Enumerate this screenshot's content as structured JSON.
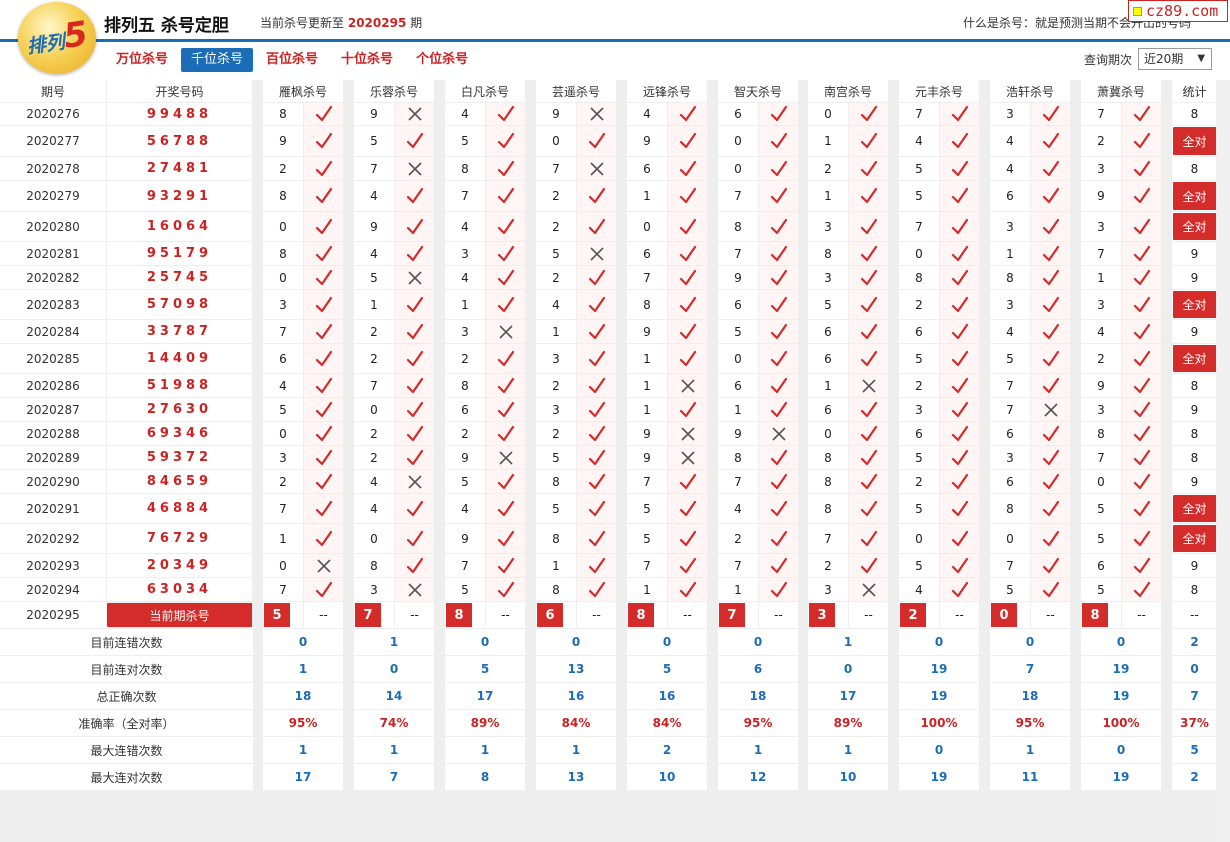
{
  "header": {
    "title": "排列五 杀号定胆",
    "logo_text": "排列",
    "logo_digit": "5",
    "update_prefix": "当前杀号更新至",
    "update_issue": "2020295",
    "update_suffix": "期",
    "what_is": "什么是杀号：就是预测当期不会开出的号码",
    "site_badge": "cz89.com"
  },
  "tabs": [
    {
      "label": "万位杀号"
    },
    {
      "label": "千位杀号"
    },
    {
      "label": "百位杀号"
    },
    {
      "label": "十位杀号"
    },
    {
      "label": "个位杀号"
    }
  ],
  "active_tab": 1,
  "query": {
    "label": "查询期次",
    "value": "近20期",
    "arrow": "▼"
  },
  "columns": {
    "issue": "期号",
    "draw": "开奖号码",
    "experts": [
      "雁枫杀号",
      "乐蓉杀号",
      "白凡杀号",
      "芸遥杀号",
      "远锋杀号",
      "智天杀号",
      "南宫杀号",
      "元丰杀号",
      "浩轩杀号",
      "萧冀杀号"
    ],
    "stat": "统计"
  },
  "rows": [
    {
      "issue": "2020276",
      "draw": "99488",
      "kills": [
        "8",
        "9",
        "4",
        "9",
        "4",
        "6",
        "0",
        "7",
        "3",
        "7"
      ],
      "ok": [
        1,
        0,
        1,
        0,
        1,
        1,
        1,
        1,
        1,
        1
      ],
      "stat": "8"
    },
    {
      "issue": "2020277",
      "draw": "56788",
      "kills": [
        "9",
        "5",
        "5",
        "0",
        "9",
        "0",
        "1",
        "4",
        "4",
        "2"
      ],
      "ok": [
        1,
        1,
        1,
        1,
        1,
        1,
        1,
        1,
        1,
        1
      ],
      "stat": "全对"
    },
    {
      "issue": "2020278",
      "draw": "27481",
      "kills": [
        "2",
        "7",
        "8",
        "7",
        "6",
        "0",
        "2",
        "5",
        "4",
        "3"
      ],
      "ok": [
        1,
        0,
        1,
        0,
        1,
        1,
        1,
        1,
        1,
        1
      ],
      "stat": "8"
    },
    {
      "issue": "2020279",
      "draw": "93291",
      "kills": [
        "8",
        "4",
        "7",
        "2",
        "1",
        "7",
        "1",
        "5",
        "6",
        "9"
      ],
      "ok": [
        1,
        1,
        1,
        1,
        1,
        1,
        1,
        1,
        1,
        1
      ],
      "stat": "全对"
    },
    {
      "issue": "2020280",
      "draw": "16064",
      "kills": [
        "0",
        "9",
        "4",
        "2",
        "0",
        "8",
        "3",
        "7",
        "3",
        "3"
      ],
      "ok": [
        1,
        1,
        1,
        1,
        1,
        1,
        1,
        1,
        1,
        1
      ],
      "stat": "全对"
    },
    {
      "issue": "2020281",
      "draw": "95179",
      "kills": [
        "8",
        "4",
        "3",
        "5",
        "6",
        "7",
        "8",
        "0",
        "1",
        "7"
      ],
      "ok": [
        1,
        1,
        1,
        0,
        1,
        1,
        1,
        1,
        1,
        1
      ],
      "stat": "9"
    },
    {
      "issue": "2020282",
      "draw": "25745",
      "kills": [
        "0",
        "5",
        "4",
        "2",
        "7",
        "9",
        "3",
        "8",
        "8",
        "1"
      ],
      "ok": [
        1,
        0,
        1,
        1,
        1,
        1,
        1,
        1,
        1,
        1
      ],
      "stat": "9"
    },
    {
      "issue": "2020283",
      "draw": "57098",
      "kills": [
        "3",
        "1",
        "1",
        "4",
        "8",
        "6",
        "5",
        "2",
        "3",
        "3"
      ],
      "ok": [
        1,
        1,
        1,
        1,
        1,
        1,
        1,
        1,
        1,
        1
      ],
      "stat": "全对"
    },
    {
      "issue": "2020284",
      "draw": "33787",
      "kills": [
        "7",
        "2",
        "3",
        "1",
        "9",
        "5",
        "6",
        "6",
        "4",
        "4"
      ],
      "ok": [
        1,
        1,
        0,
        1,
        1,
        1,
        1,
        1,
        1,
        1
      ],
      "stat": "9"
    },
    {
      "issue": "2020285",
      "draw": "14409",
      "kills": [
        "6",
        "2",
        "2",
        "3",
        "1",
        "0",
        "6",
        "5",
        "5",
        "2"
      ],
      "ok": [
        1,
        1,
        1,
        1,
        1,
        1,
        1,
        1,
        1,
        1
      ],
      "stat": "全对"
    },
    {
      "issue": "2020286",
      "draw": "51988",
      "kills": [
        "4",
        "7",
        "8",
        "2",
        "1",
        "6",
        "1",
        "2",
        "7",
        "9"
      ],
      "ok": [
        1,
        1,
        1,
        1,
        0,
        1,
        0,
        1,
        1,
        1
      ],
      "stat": "8"
    },
    {
      "issue": "2020287",
      "draw": "27630",
      "kills": [
        "5",
        "0",
        "6",
        "3",
        "1",
        "1",
        "6",
        "3",
        "7",
        "3"
      ],
      "ok": [
        1,
        1,
        1,
        1,
        1,
        1,
        1,
        1,
        0,
        1
      ],
      "stat": "9"
    },
    {
      "issue": "2020288",
      "draw": "69346",
      "kills": [
        "0",
        "2",
        "2",
        "2",
        "9",
        "9",
        "0",
        "6",
        "6",
        "8"
      ],
      "ok": [
        1,
        1,
        1,
        1,
        0,
        0,
        1,
        1,
        1,
        1
      ],
      "stat": "8"
    },
    {
      "issue": "2020289",
      "draw": "59372",
      "kills": [
        "3",
        "2",
        "9",
        "5",
        "9",
        "8",
        "8",
        "5",
        "3",
        "7"
      ],
      "ok": [
        1,
        1,
        0,
        1,
        0,
        1,
        1,
        1,
        1,
        1
      ],
      "stat": "8"
    },
    {
      "issue": "2020290",
      "draw": "84659",
      "kills": [
        "2",
        "4",
        "5",
        "8",
        "7",
        "7",
        "8",
        "2",
        "6",
        "0"
      ],
      "ok": [
        1,
        0,
        1,
        1,
        1,
        1,
        1,
        1,
        1,
        1
      ],
      "stat": "9"
    },
    {
      "issue": "2020291",
      "draw": "46884",
      "kills": [
        "7",
        "4",
        "4",
        "5",
        "5",
        "4",
        "8",
        "5",
        "8",
        "5"
      ],
      "ok": [
        1,
        1,
        1,
        1,
        1,
        1,
        1,
        1,
        1,
        1
      ],
      "stat": "全对"
    },
    {
      "issue": "2020292",
      "draw": "76729",
      "kills": [
        "1",
        "0",
        "9",
        "8",
        "5",
        "2",
        "7",
        "0",
        "0",
        "5"
      ],
      "ok": [
        1,
        1,
        1,
        1,
        1,
        1,
        1,
        1,
        1,
        1
      ],
      "stat": "全对"
    },
    {
      "issue": "2020293",
      "draw": "20349",
      "kills": [
        "0",
        "8",
        "7",
        "1",
        "7",
        "7",
        "2",
        "5",
        "7",
        "6"
      ],
      "ok": [
        0,
        1,
        1,
        1,
        1,
        1,
        1,
        1,
        1,
        1
      ],
      "stat": "9"
    },
    {
      "issue": "2020294",
      "draw": "63034",
      "kills": [
        "7",
        "3",
        "5",
        "8",
        "1",
        "1",
        "3",
        "4",
        "5",
        "5"
      ],
      "ok": [
        1,
        0,
        1,
        1,
        1,
        1,
        0,
        1,
        1,
        1
      ],
      "stat": "8"
    }
  ],
  "current": {
    "issue": "2020295",
    "label": "当前期杀号",
    "kills": [
      "5",
      "7",
      "8",
      "6",
      "8",
      "7",
      "3",
      "2",
      "0",
      "8"
    ],
    "dash": "--"
  },
  "stats": [
    {
      "label": "目前连错次数",
      "values": [
        "0",
        "1",
        "0",
        "0",
        "0",
        "0",
        "1",
        "0",
        "0",
        "0",
        "2"
      ],
      "color": "blue"
    },
    {
      "label": "目前连对次数",
      "values": [
        "1",
        "0",
        "5",
        "13",
        "5",
        "6",
        "0",
        "19",
        "7",
        "19",
        "0"
      ],
      "color": "blue"
    },
    {
      "label": "总正确次数",
      "values": [
        "18",
        "14",
        "17",
        "16",
        "16",
        "18",
        "17",
        "19",
        "18",
        "19",
        "7"
      ],
      "color": "blue"
    },
    {
      "label": "准确率（全对率）",
      "values": [
        "95%",
        "74%",
        "89%",
        "84%",
        "84%",
        "95%",
        "89%",
        "100%",
        "95%",
        "100%",
        "37%"
      ],
      "color": "red"
    },
    {
      "label": "最大连错次数",
      "values": [
        "1",
        "1",
        "1",
        "1",
        "2",
        "1",
        "1",
        "0",
        "1",
        "0",
        "5"
      ],
      "color": "blue"
    },
    {
      "label": "最大连对次数",
      "values": [
        "17",
        "7",
        "8",
        "13",
        "10",
        "12",
        "10",
        "19",
        "11",
        "19",
        "2"
      ],
      "color": "blue"
    }
  ],
  "colors": {
    "brand_blue": "#1b6db8",
    "red": "#d42b2b",
    "check": "#d42b2b",
    "cross": "#555555"
  }
}
